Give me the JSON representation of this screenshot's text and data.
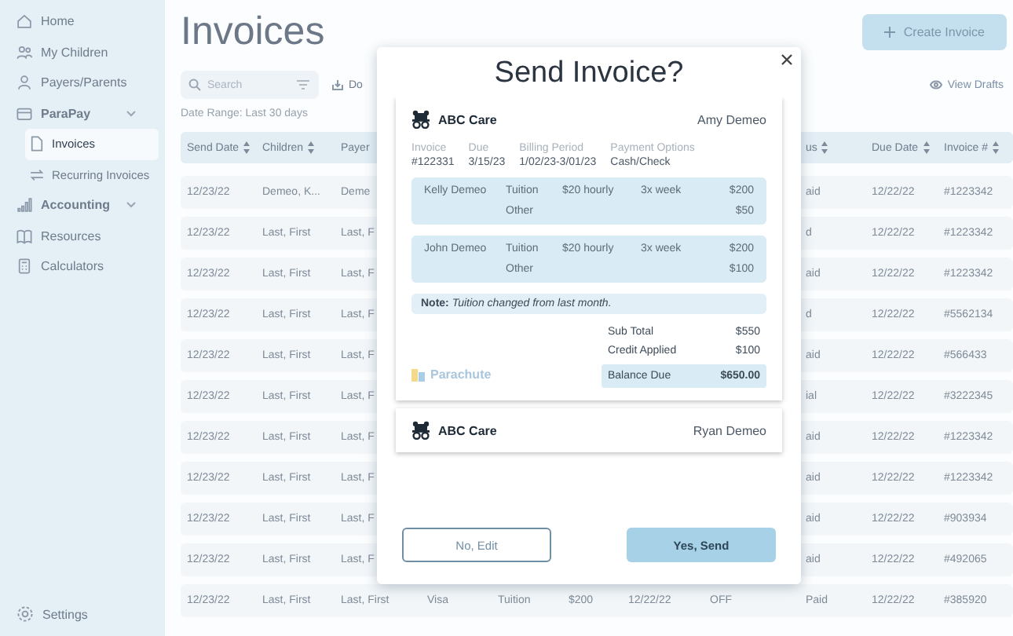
{
  "sidebar": {
    "items": [
      {
        "label": "Home",
        "kind": "link",
        "selected": false
      },
      {
        "label": "My Children",
        "kind": "link",
        "selected": false
      },
      {
        "label": "Payers/Parents",
        "kind": "link",
        "selected": false
      },
      {
        "label": "ParaPay",
        "kind": "group",
        "selected": false,
        "children": [
          {
            "label": "Invoices",
            "selected": true
          },
          {
            "label": "Recurring Invoices",
            "selected": false
          }
        ]
      },
      {
        "label": "Accounting",
        "kind": "group",
        "selected": false
      },
      {
        "label": "Resources",
        "kind": "link",
        "selected": false
      },
      {
        "label": "Calculators",
        "kind": "link",
        "selected": false
      }
    ],
    "footer": {
      "label": "Settings"
    }
  },
  "page": {
    "title": "Invoices",
    "create_button": "Create Invoice",
    "drafts_link": "View Drafts",
    "search": {
      "placeholder": "Search"
    },
    "download_label": "Do",
    "date_range": "Date Range: Last 30 days"
  },
  "table": {
    "columns": [
      {
        "label": "Send Date",
        "sortable": true
      },
      {
        "label": "Children",
        "sortable": true
      },
      {
        "label": "Payer"
      },
      {
        "label": "us",
        "sortable": true
      },
      {
        "label": "Due Date",
        "sortable": true
      },
      {
        "label": "Invoice #",
        "sortable": true
      }
    ],
    "rows": [
      {
        "cells": [
          "12/23/22",
          "Demeo, K...",
          "Deme",
          "aid",
          "12/22/22",
          "#1223342"
        ]
      },
      {
        "cells": [
          "12/23/22",
          "Last, First",
          "Last, F",
          "d",
          "12/22/22",
          "#1223342"
        ]
      },
      {
        "cells": [
          "12/23/22",
          "Last, First",
          "Last, F",
          "aid",
          "12/22/22",
          "#1223342"
        ]
      },
      {
        "cells": [
          "12/23/22",
          "Last, First",
          "Last, F",
          "d",
          "12/22/22",
          "#5562134"
        ]
      },
      {
        "cells": [
          "12/23/22",
          "Last, First",
          "Last, F",
          "aid",
          "12/22/22",
          "#566433"
        ]
      },
      {
        "cells": [
          "12/23/22",
          "Last, First",
          "Last, F",
          "ial",
          "12/22/22",
          "#3222345"
        ]
      },
      {
        "cells": [
          "12/23/22",
          "Last, First",
          "Last, F",
          "aid",
          "12/22/22",
          "#1223342"
        ]
      },
      {
        "cells": [
          "12/23/22",
          "Last, First",
          "Last, F",
          "aid",
          "12/22/22",
          "#1223342"
        ]
      },
      {
        "cells": [
          "12/23/22",
          "Last, First",
          "Last, F",
          "aid",
          "12/22/22",
          "#903934"
        ]
      },
      {
        "cells": [
          "12/23/22",
          "Last, First",
          "Last, F",
          "aid",
          "12/22/22",
          "#492065"
        ]
      },
      {
        "cells": [
          "12/23/22",
          "Last, First",
          "Last, First",
          "Paid",
          "12/22/22",
          "#385920"
        ],
        "middle": [
          "Visa",
          "Tuition",
          "$200",
          "12/22/22",
          "OFF"
        ]
      }
    ]
  },
  "modal": {
    "title": "Send Invoice?",
    "invoices": [
      {
        "provider": "ABC Care",
        "payer": "Amy Demeo",
        "meta": [
          {
            "label": "Invoice",
            "value": "#122331"
          },
          {
            "label": "Due",
            "value": "3/15/23"
          },
          {
            "label": "Billing Period",
            "value": "1/02/23-3/01/23"
          },
          {
            "label": "Payment Options",
            "value": "Cash/Check"
          }
        ],
        "children": [
          {
            "name": "Kelly Demeo",
            "lines": [
              {
                "type": "Tuition",
                "rate": "$20 hourly",
                "frequency": "3x week",
                "amount": "$200"
              },
              {
                "type": "Other",
                "amount": "$50"
              }
            ]
          },
          {
            "name": "John Demeo",
            "lines": [
              {
                "type": "Tuition",
                "rate": "$20 hourly",
                "frequency": "3x week",
                "amount": "$200"
              },
              {
                "type": "Other",
                "amount": "$100"
              }
            ]
          }
        ],
        "note": "**Note:** *Tuition changed from last month.*",
        "totals": [
          {
            "label": "Sub Total",
            "value": "$550"
          },
          {
            "label": "Credit Applied",
            "value": "$100"
          }
        ],
        "balance": {
          "label": "Balance Due",
          "value": "$650.00"
        },
        "logo": "Parachute"
      },
      {
        "provider": "ABC Care",
        "payer": "Ryan Demeo"
      }
    ],
    "buttons": [
      {
        "label": "No, Edit",
        "kind": "secondary"
      },
      {
        "label": "Yes, Send",
        "kind": "primary"
      }
    ]
  }
}
